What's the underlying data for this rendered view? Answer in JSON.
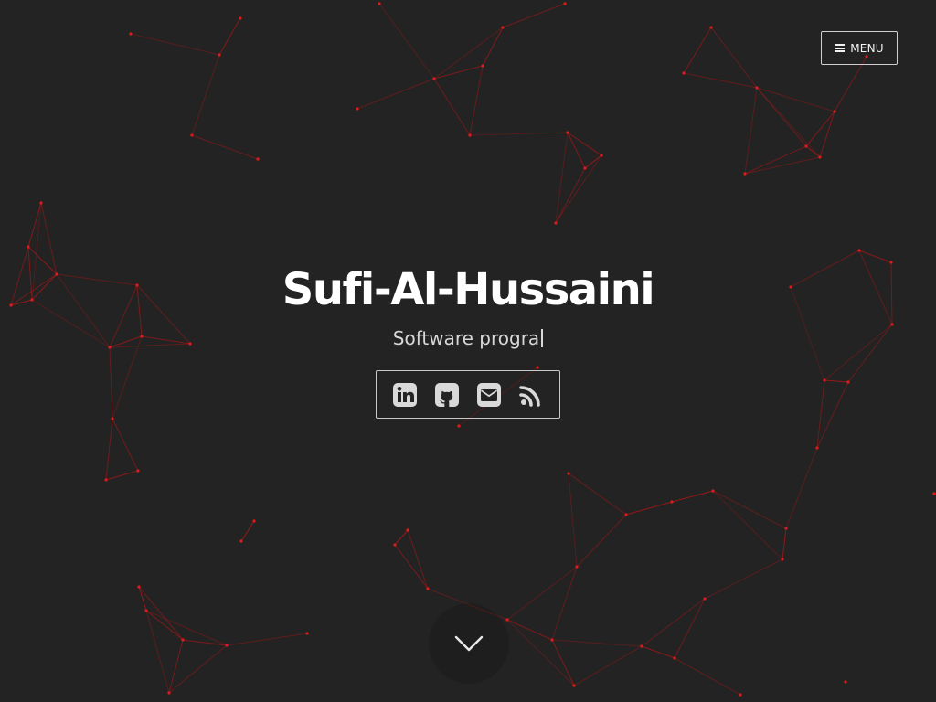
{
  "site": {
    "title": "Sufi-Al-Hussaini",
    "subtitle_typed": "Software progra"
  },
  "nav": {
    "menu_label": "MENU"
  },
  "social_links": [
    {
      "name": "linkedin",
      "icon": "linkedin-icon"
    },
    {
      "name": "github",
      "icon": "github-icon"
    },
    {
      "name": "email",
      "icon": "email-icon"
    },
    {
      "name": "rss",
      "icon": "rss-icon"
    }
  ],
  "scroll": {
    "icon": "chevron-down-icon"
  },
  "colors": {
    "background": "#232323",
    "network_line": "#b01616",
    "network_node": "#e01b1b",
    "text": "#ffffff",
    "icon": "#d9d9d9",
    "border": "#cfcfcf"
  }
}
